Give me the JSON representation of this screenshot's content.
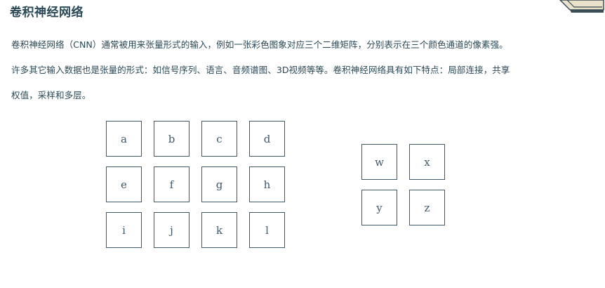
{
  "heading": "卷积神经网络",
  "paragraph": {
    "line1": "卷积神经网络（CNN）通常被用来张量形式的输入，例如一张彩色图象对应三个二维矩阵，分别表示在三个颜色通道的像素强。",
    "line2": "许多其它输入数据也是张量的形式：如信号序列、语言、音频谱图、3D视频等等。卷积神经网络具有如下特点：局部连接，共享",
    "line3": "权值，采样和多层。"
  },
  "input_matrix": [
    [
      "a",
      "b",
      "c",
      "d"
    ],
    [
      "e",
      "f",
      "g",
      "h"
    ],
    [
      "i",
      "j",
      "k",
      "l"
    ]
  ],
  "kernel_matrix": [
    [
      "w",
      "x"
    ],
    [
      "y",
      "z"
    ]
  ],
  "icons": {
    "corner": "book-icon"
  }
}
